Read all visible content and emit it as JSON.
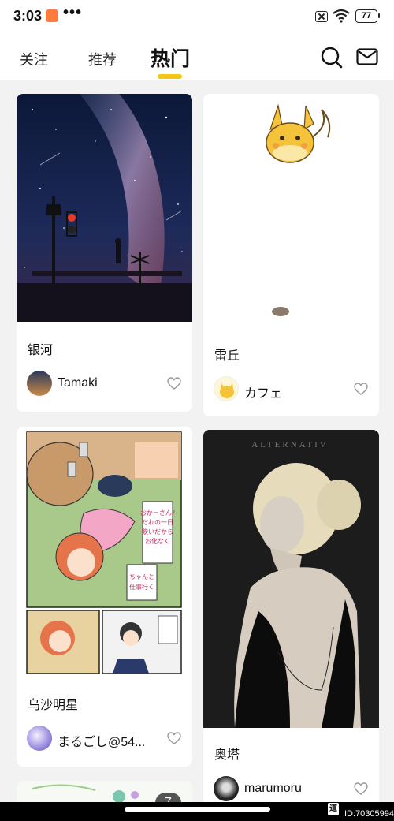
{
  "status": {
    "time": "3:03",
    "dots": "•••",
    "battery": "77"
  },
  "nav": {
    "follow": "关注",
    "recommend": "推荐",
    "hot": "热门"
  },
  "cards": [
    {
      "title": "银河",
      "author": "Tamaki"
    },
    {
      "title": "雷丘",
      "author": "カフェ"
    },
    {
      "title": "乌沙明星",
      "author": "まるごし@54..."
    },
    {
      "title": "奥塔",
      "author": "marumoru",
      "image_caption": "ALTERNATIV"
    }
  ],
  "manga": {
    "bubble1": "おかーさん?だれの一日飲いだから お化なくしていいって",
    "bubble2": "ちゃんと仕事行くから"
  },
  "badge": "7",
  "watermark": "ID:70305994",
  "colors": {
    "accent": "#f5c518",
    "background": "#f2f2f2",
    "card": "#ffffff"
  },
  "icons": [
    "search-icon",
    "mail-icon",
    "heart-icon",
    "wifi-icon",
    "battery-icon"
  ]
}
